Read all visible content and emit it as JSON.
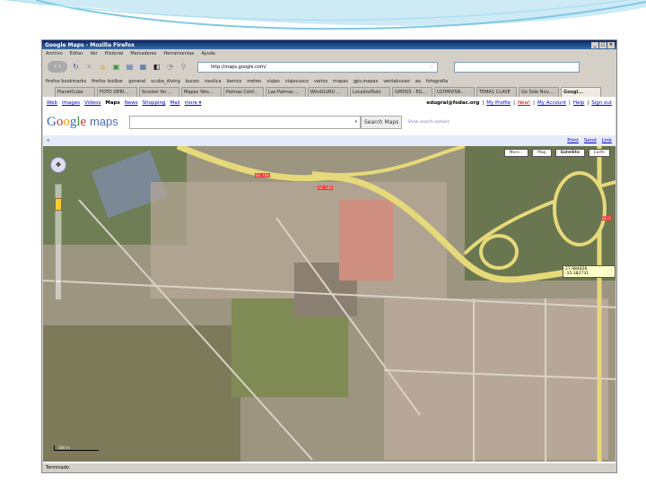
{
  "window": {
    "title": "Google Maps - Mozilla Firefox",
    "controls": [
      "_",
      "□",
      "×"
    ]
  },
  "menu": [
    "Archivo",
    "Editar",
    "Ver",
    "Historial",
    "Marcadores",
    "Herramientas",
    "Ayuda"
  ],
  "toolbar": {
    "url": "http://maps.google.com/",
    "icons": [
      "back-forward",
      "reload",
      "stop",
      "home",
      "bookmark",
      "rss",
      "calendar",
      "window",
      "history",
      "pin"
    ]
  },
  "bookmarks": [
    "firefox bookmarks",
    "firefox toolbar",
    "general",
    "scuba_diving",
    "buceo",
    "nautica",
    "barcos",
    "meteo",
    "viajes",
    "viajecusco",
    "varios",
    "mapas",
    "gps,mapas",
    "ventabuceo",
    "aa",
    "fotografia"
  ],
  "tabs": [
    {
      "label": "PlanetCube"
    },
    {
      "label": "FOTO DEBI..."
    },
    {
      "label": "Scooter for ..."
    },
    {
      "label": "Mapas Yets..."
    },
    {
      "label": "Palmas Conf..."
    },
    {
      "label": "Las Palmas ..."
    },
    {
      "label": "WindGURU ..."
    },
    {
      "label": "LocalizaTodo"
    },
    {
      "label": "GMDSS - EG..."
    },
    {
      "label": "ULTIMVISN..."
    },
    {
      "label": "TEMA1 CLAVE"
    },
    {
      "label": "Go Sole Nou..."
    },
    {
      "label": "Googl...",
      "active": true
    }
  ],
  "google": {
    "links": [
      "Web",
      "Images",
      "Videos",
      "Maps",
      "News",
      "Shopping",
      "Mail",
      "more ▾"
    ],
    "active_link": "Maps",
    "user": "edugral@fodac.org",
    "account_links": [
      "My Profile",
      "New!",
      "My Account",
      "Help",
      "Sign out"
    ],
    "logo": "Google",
    "logo_suffix": "maps",
    "search_value": "",
    "search_button": "Search Maps",
    "options_link": "Show search options"
  },
  "actions": [
    "Print",
    "Send",
    "Link"
  ],
  "map": {
    "type_buttons": [
      "More...",
      "Map",
      "Satellite",
      "Earth"
    ],
    "selected_type": "Satellite",
    "coordinates": "27.984826, -15.382731",
    "road_labels": [
      "GC-100",
      "GC-100",
      "GC-1"
    ],
    "scale": "100 m"
  },
  "status": "Terminado"
}
